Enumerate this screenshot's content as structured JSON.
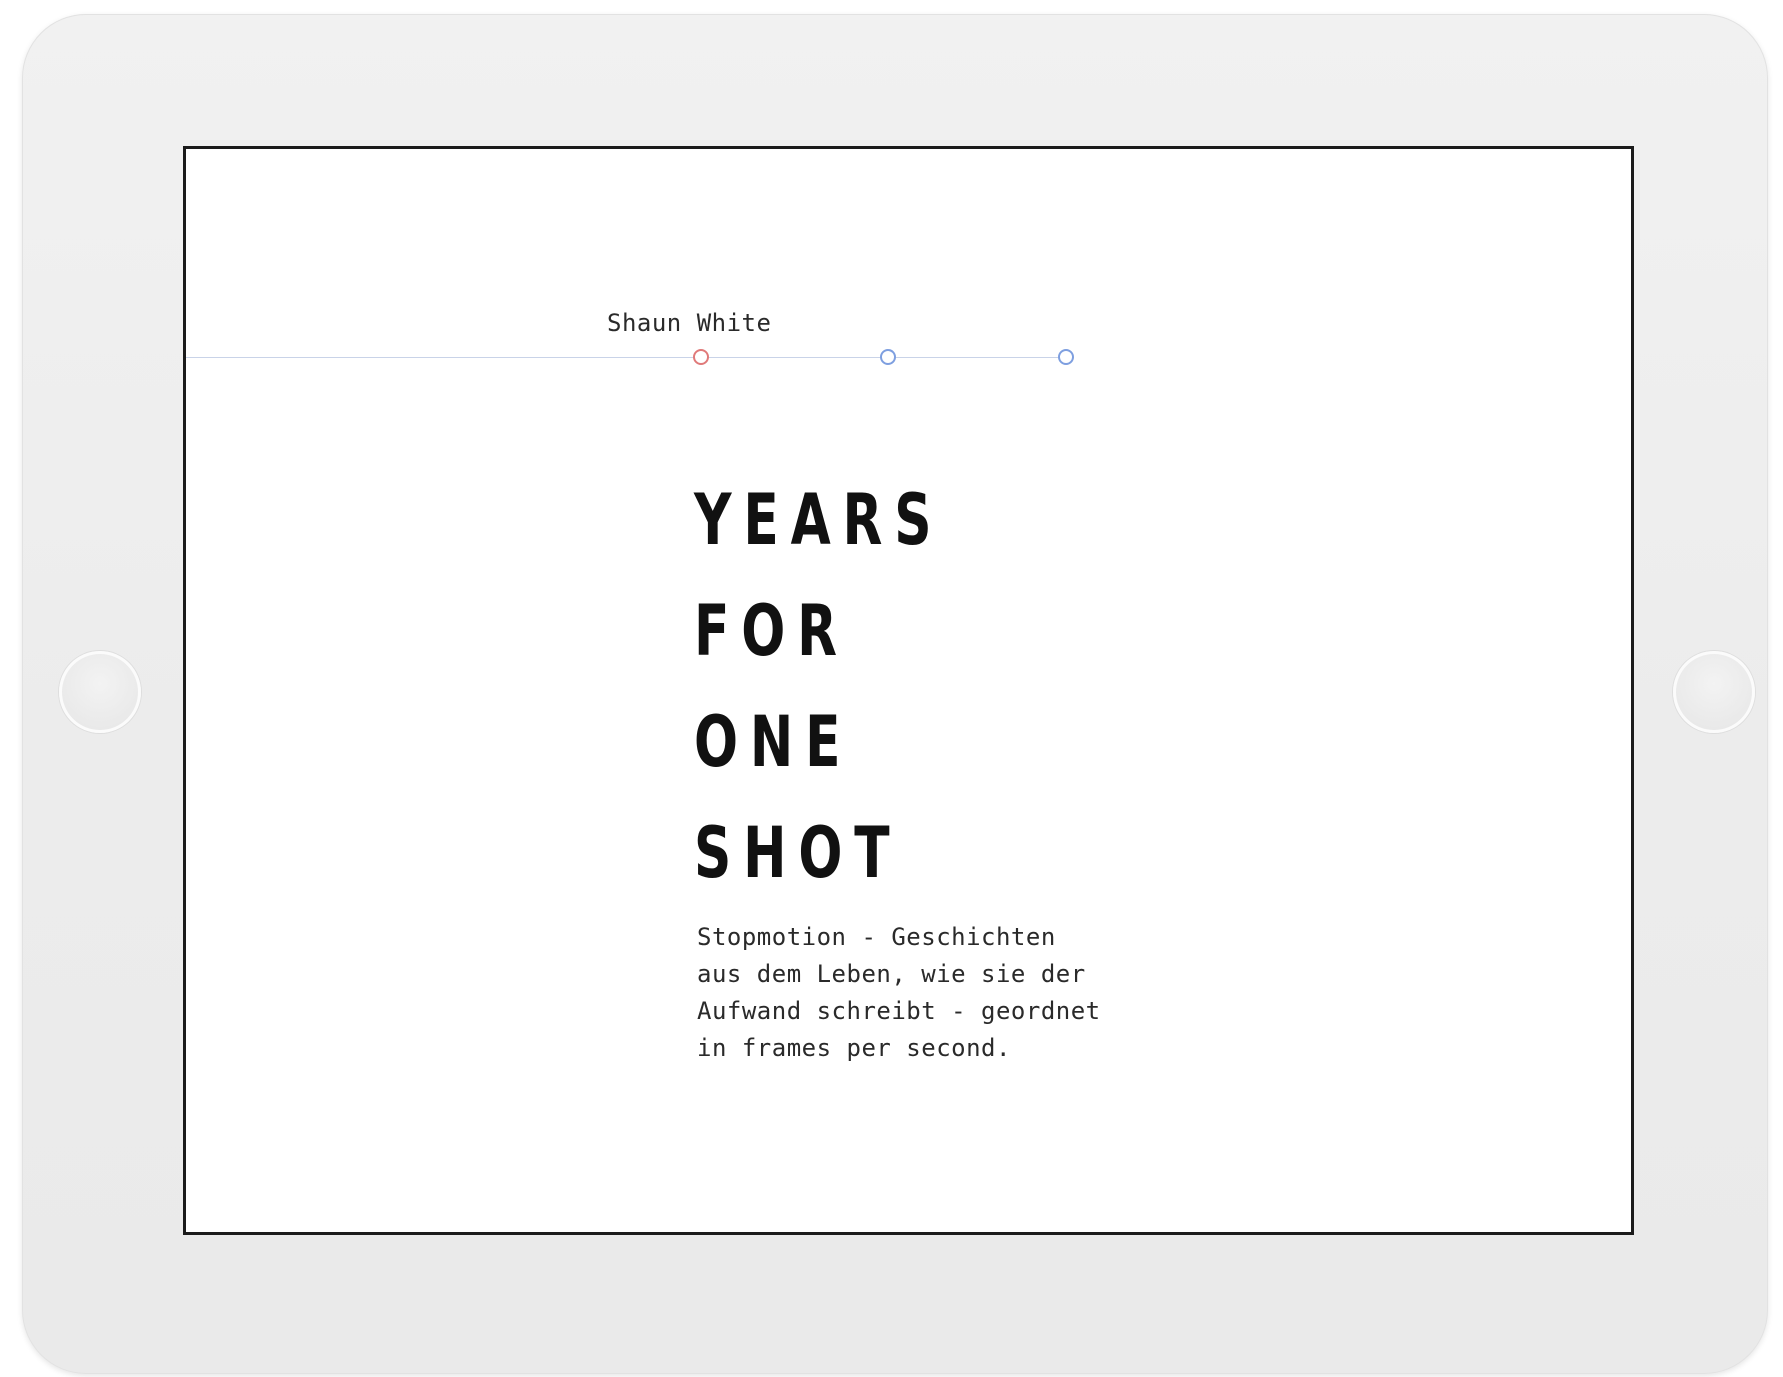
{
  "timeline": {
    "active_label": "Shaun White",
    "active_index": 0,
    "nodes": [
      "active",
      "inactive",
      "inactive"
    ]
  },
  "headline": {
    "lines": [
      "YEARS",
      "FOR",
      "ONE",
      "SHOT"
    ]
  },
  "description": {
    "lines": [
      "Stopmotion - Geschichten",
      "aus dem Leben, wie sie der",
      "Aufwand schreibt - geordnet",
      "in frames per second."
    ]
  },
  "colors": {
    "active_node": "#e07a7a",
    "inactive_node": "#7e9fe0",
    "timeline_line": "#c9d3e8",
    "text": "#111111",
    "device": "#eeeeee"
  }
}
